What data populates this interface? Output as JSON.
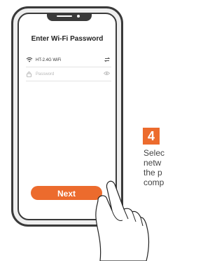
{
  "dialog": {
    "title": "Enter Wi-Fi Password",
    "wifi": {
      "name": "HT-2.4G WiFi",
      "icon": "wifi-icon",
      "action_icon": "switch-network-icon"
    },
    "password": {
      "placeholder": "Password",
      "icon": "lock-icon",
      "toggle_icon": "eye-icon"
    },
    "next_label": "Next"
  },
  "step": {
    "number": "4",
    "caption_lines": [
      "Selec",
      "netw",
      "the p",
      "comp"
    ]
  },
  "colors": {
    "accent": "#ec6b2d",
    "device": "#3a3a3a",
    "device_body": "#efefef"
  }
}
